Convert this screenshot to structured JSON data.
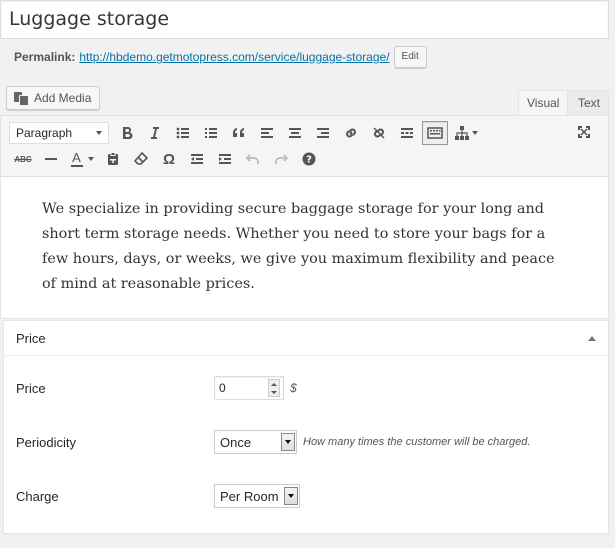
{
  "title": "Luggage storage",
  "permalink": {
    "label": "Permalink:",
    "url": "http://hbdemo.getmotopress.com/service/luggage-storage/",
    "edit_label": "Edit"
  },
  "media": {
    "add_label": "Add Media"
  },
  "editor_tabs": {
    "visual": "Visual",
    "text": "Text"
  },
  "toolbar": {
    "format_value": "Paragraph",
    "row1": [
      "bold-icon",
      "italic-icon",
      "bullet-list-icon",
      "numbered-list-icon",
      "blockquote-icon",
      "align-left-icon",
      "align-center-icon",
      "align-right-icon",
      "link-icon",
      "unlink-icon",
      "read-more-icon",
      "toolbar-toggle-icon",
      "sitemap-icon"
    ],
    "row2": [
      "strikethrough-icon",
      "horizontal-line-icon",
      "text-color-icon",
      "paste-text-icon",
      "clear-formatting-icon",
      "special-character-icon",
      "outdent-icon",
      "indent-icon",
      "undo-icon",
      "redo-icon",
      "help-icon"
    ],
    "strike_label": "ABC",
    "color_label": "A",
    "omega": "Ω"
  },
  "content": "We specialize in providing secure baggage storage for your long and short term storage needs. Whether you need to store your bags for a few hours, days, or weeks, we give you maximum flexibility and peace of mind at reasonable prices.",
  "price_box": {
    "title": "Price",
    "price_label": "Price",
    "price_value": "0",
    "currency": "$",
    "periodicity_label": "Periodicity",
    "periodicity_value": "Once",
    "periodicity_help": "How many times the customer will be charged.",
    "charge_label": "Charge",
    "charge_value": "Per Room"
  },
  "colors": {
    "link": "#0073aa",
    "toolbar_bg": "#f5f5f5",
    "page_bg": "#f1f1f1"
  }
}
